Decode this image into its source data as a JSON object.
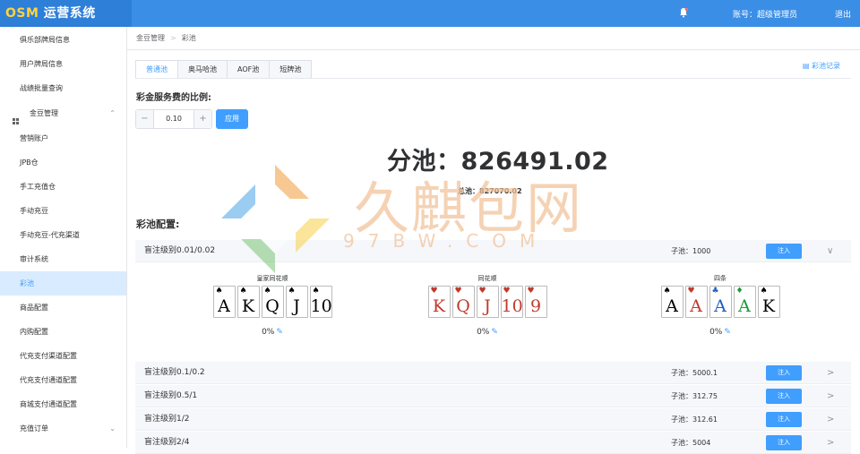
{
  "app": {
    "logo_prefix": "OSM",
    "logo_rest": " 运营系统"
  },
  "header": {
    "account": "账号：超级管理员",
    "logout": "退出"
  },
  "sidebar": {
    "items": [
      {
        "label": "俱乐部牌局信息"
      },
      {
        "label": "用户牌局信息"
      },
      {
        "label": "战绩批量查询"
      },
      {
        "label": "金豆管理",
        "group": true,
        "arrow": "^"
      },
      {
        "label": "营销账户"
      },
      {
        "label": "JPB仓"
      },
      {
        "label": "手工充值仓"
      },
      {
        "label": "手动充豆"
      },
      {
        "label": "手动充豆-代充渠道"
      },
      {
        "label": "审计系统"
      },
      {
        "label": "彩池",
        "active": true
      },
      {
        "label": "商品配置"
      },
      {
        "label": "内购配置"
      },
      {
        "label": "代充支付渠道配置"
      },
      {
        "label": "代充支付通道配置"
      },
      {
        "label": "商城支付通道配置"
      },
      {
        "label": "充值订单",
        "arrow": "v"
      }
    ]
  },
  "breadcrumb": {
    "parent": "金豆管理",
    "sep": ">",
    "current": "彩池"
  },
  "tabs": [
    "普通池",
    "奥马哈池",
    "AOF池",
    "短牌池"
  ],
  "record_link": "彩池记录",
  "fee": {
    "label": "彩金服务费的比例:",
    "value": "0.10",
    "minus": "−",
    "plus": "+",
    "apply": "应用"
  },
  "pool": {
    "subpool": "分池：826491.02",
    "total": "总池：827070.02"
  },
  "watermark": {
    "text": "久麒包网",
    "sub": "97BW.COM"
  },
  "config_label": "彩池配置:",
  "inject_label": "注入",
  "levels": [
    {
      "label": "盲注级别0.01/0.02",
      "pool": "子池：1000",
      "chevron": "∨"
    },
    {
      "label": "盲注级别0.1/0.2",
      "pool": "子池：5000.1",
      "chevron": ">"
    },
    {
      "label": "盲注级别0.5/1",
      "pool": "子池：312.75",
      "chevron": ">"
    },
    {
      "label": "盲注级别1/2",
      "pool": "子池：312.61",
      "chevron": ">"
    },
    {
      "label": "盲注级别2/4",
      "pool": "子池：5004",
      "chevron": ">"
    }
  ],
  "hands": [
    {
      "title": "皇家同花顺",
      "pct": "0%",
      "cards": [
        {
          "rank": "A",
          "suit": "♠",
          "color": "#000000"
        },
        {
          "rank": "K",
          "suit": "♠",
          "color": "#000000"
        },
        {
          "rank": "Q",
          "suit": "♠",
          "color": "#000000"
        },
        {
          "rank": "J",
          "suit": "♠",
          "color": "#000000"
        },
        {
          "rank": "10",
          "suit": "♠",
          "color": "#000000"
        }
      ]
    },
    {
      "title": "同花顺",
      "pct": "0%",
      "cards": [
        {
          "rank": "K",
          "suit": "♥",
          "color": "#c0392b"
        },
        {
          "rank": "Q",
          "suit": "♥",
          "color": "#c0392b"
        },
        {
          "rank": "J",
          "suit": "♥",
          "color": "#c0392b"
        },
        {
          "rank": "10",
          "suit": "♥",
          "color": "#c0392b"
        },
        {
          "rank": "9",
          "suit": "♥",
          "color": "#c0392b"
        }
      ]
    },
    {
      "title": "四条",
      "pct": "0%",
      "cards": [
        {
          "rank": "A",
          "suit": "♠",
          "color": "#000000"
        },
        {
          "rank": "A",
          "suit": "♥",
          "color": "#c0392b"
        },
        {
          "rank": "A",
          "suit": "♣",
          "color": "#1f5fbf"
        },
        {
          "rank": "A",
          "suit": "♦",
          "color": "#1a9a3a"
        },
        {
          "rank": "K",
          "suit": "♠",
          "color": "#000000"
        }
      ]
    }
  ]
}
